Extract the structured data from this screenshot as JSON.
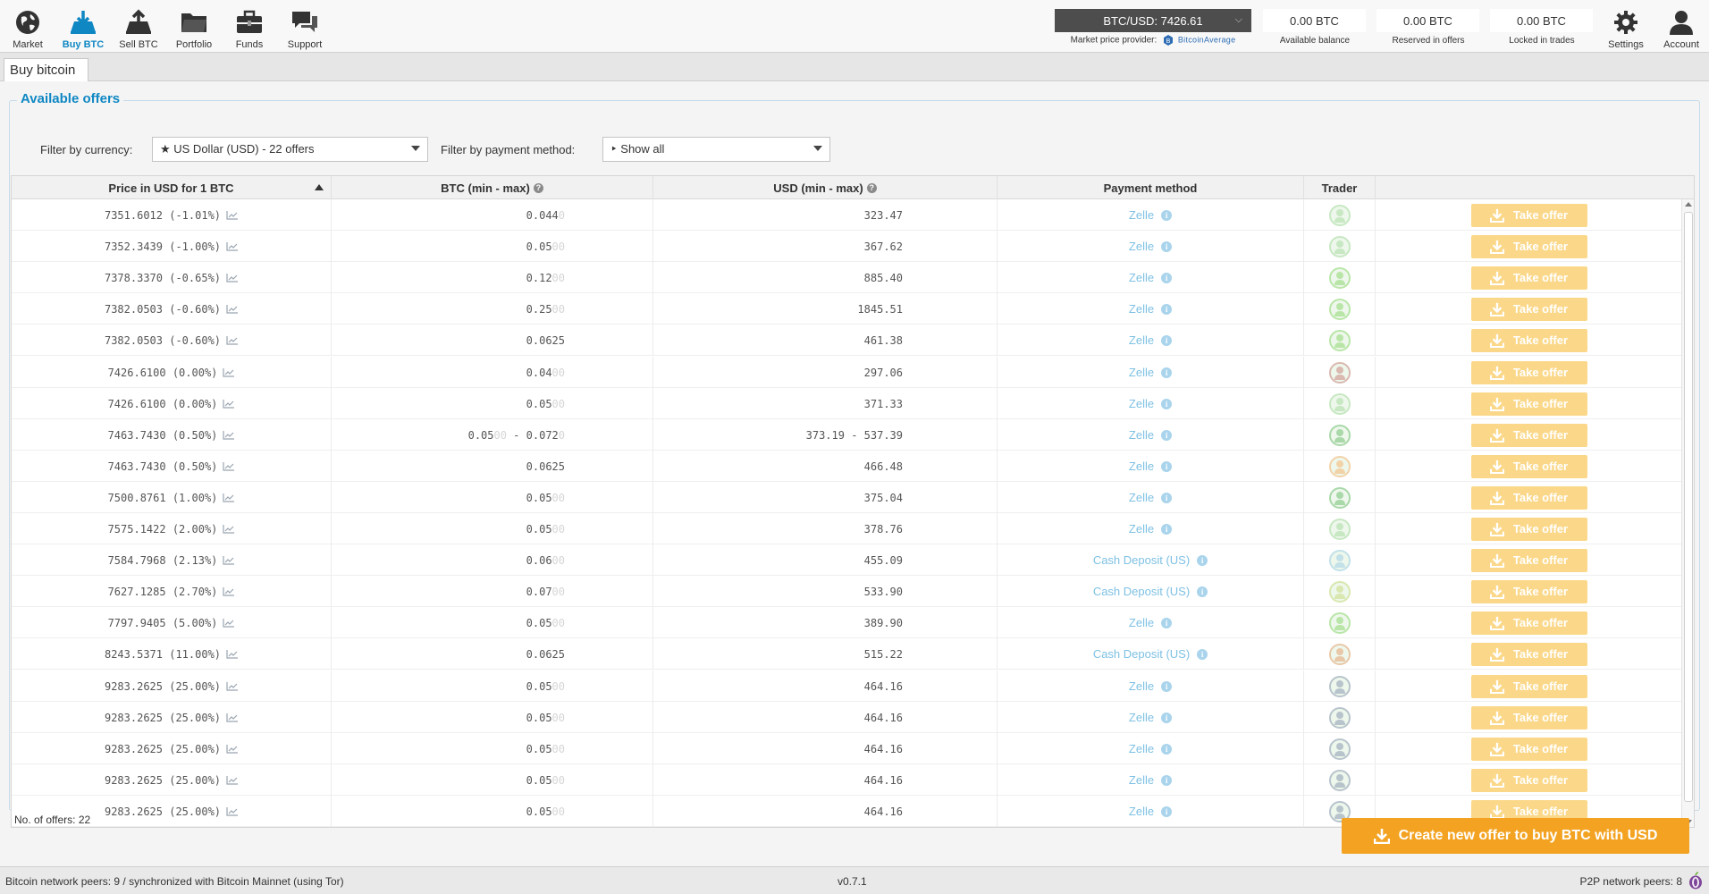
{
  "nav": {
    "items": [
      {
        "label": "Market",
        "icon": "globe-icon"
      },
      {
        "label": "Buy BTC",
        "icon": "buy-btc-icon",
        "active": true
      },
      {
        "label": "Sell BTC",
        "icon": "sell-btc-icon"
      },
      {
        "label": "Portfolio",
        "icon": "folder-icon"
      },
      {
        "label": "Funds",
        "icon": "briefcase-icon"
      },
      {
        "label": "Support",
        "icon": "chat-icon"
      }
    ],
    "settings_label": "Settings",
    "account_label": "Account"
  },
  "market_price": {
    "value": "BTC/USD: 7426.61",
    "provider_label": "Market price provider:",
    "provider_name": "BitcoinAverage"
  },
  "balances": {
    "available": {
      "value": "0.00 BTC",
      "label": "Available balance"
    },
    "reserved": {
      "value": "0.00 BTC",
      "label": "Reserved in offers"
    },
    "locked": {
      "value": "0.00 BTC",
      "label": "Locked in trades"
    }
  },
  "tab": {
    "label": "Buy bitcoin"
  },
  "offers": {
    "title": "Available offers",
    "filter_currency_label": "Filter by currency:",
    "filter_currency_value": "★ US Dollar (USD) - 22 offers",
    "filter_payment_label": "Filter by payment method:",
    "filter_payment_value": "‣ Show all",
    "columns": {
      "price": "Price in USD for 1 BTC",
      "btc": "BTC (min - max)",
      "usd": "USD (min - max)",
      "payment": "Payment method",
      "trader": "Trader"
    },
    "take_label": "Take offer",
    "rows": [
      {
        "price": "7351.6012 (-1.01%)",
        "btc": "0.044",
        "btc_pad": "0",
        "usd": "323.47",
        "payment": "Zelle",
        "avatar_color": "#c7e8c2"
      },
      {
        "price": "7352.3439 (-1.00%)",
        "btc": "0.05",
        "btc_pad": "00",
        "usd": "367.62",
        "payment": "Zelle",
        "avatar_color": "#c7e8c2"
      },
      {
        "price": "7378.3370 (-0.65%)",
        "btc": "0.12",
        "btc_pad": "00",
        "usd": "885.40",
        "payment": "Zelle",
        "avatar_color": "#b9e6a8"
      },
      {
        "price": "7382.0503 (-0.60%)",
        "btc": "0.25",
        "btc_pad": "00",
        "usd": "1845.51",
        "payment": "Zelle",
        "avatar_color": "#b9e6a8"
      },
      {
        "price": "7382.0503 (-0.60%)",
        "btc": "0.0625",
        "btc_pad": "",
        "usd": "461.38",
        "payment": "Zelle",
        "avatar_color": "#b9e6a8"
      },
      {
        "price": "7426.6100 (0.00%)",
        "btc": "0.04",
        "btc_pad": "00",
        "usd": "297.06",
        "payment": "Zelle",
        "avatar_color": "#d9b9b0"
      },
      {
        "price": "7426.6100 (0.00%)",
        "btc": "0.05",
        "btc_pad": "00",
        "usd": "371.33",
        "payment": "Zelle",
        "avatar_color": "#c7e8c2"
      },
      {
        "price": "7463.7430 (0.50%)",
        "btc": "0.05",
        "btc_pad": "00",
        "btc_max": "0.072",
        "btc_max_pad": "0",
        "usd": "373.19 - 537.39",
        "payment": "Zelle",
        "avatar_color": "#a9d8a9"
      },
      {
        "price": "7463.7430 (0.50%)",
        "btc": "0.0625",
        "btc_pad": "",
        "usd": "466.48",
        "payment": "Zelle",
        "avatar_color": "#f2d3a8"
      },
      {
        "price": "7500.8761 (1.00%)",
        "btc": "0.05",
        "btc_pad": "00",
        "usd": "375.04",
        "payment": "Zelle",
        "avatar_color": "#a9d8a9"
      },
      {
        "price": "7575.1422 (2.00%)",
        "btc": "0.05",
        "btc_pad": "00",
        "usd": "378.76",
        "payment": "Zelle",
        "avatar_color": "#c7e8c2"
      },
      {
        "price": "7584.7968 (2.13%)",
        "btc": "0.06",
        "btc_pad": "00",
        "usd": "455.09",
        "payment": "Cash Deposit (US)",
        "avatar_color": "#c2e1e8"
      },
      {
        "price": "7627.1285 (2.70%)",
        "btc": "0.07",
        "btc_pad": "00",
        "usd": "533.90",
        "payment": "Cash Deposit (US)",
        "avatar_color": "#d8e8b0"
      },
      {
        "price": "7797.9405 (5.00%)",
        "btc": "0.05",
        "btc_pad": "00",
        "usd": "389.90",
        "payment": "Zelle",
        "avatar_color": "#b9e6a8"
      },
      {
        "price": "8243.5371 (11.00%)",
        "btc": "0.0625",
        "btc_pad": "",
        "usd": "515.22",
        "payment": "Cash Deposit (US)",
        "avatar_color": "#e8c8a8"
      },
      {
        "price": "9283.2625 (25.00%)",
        "btc": "0.05",
        "btc_pad": "00",
        "usd": "464.16",
        "payment": "Zelle",
        "avatar_color": "#b8c4cc"
      },
      {
        "price": "9283.2625 (25.00%)",
        "btc": "0.05",
        "btc_pad": "00",
        "usd": "464.16",
        "payment": "Zelle",
        "avatar_color": "#b8c4cc"
      },
      {
        "price": "9283.2625 (25.00%)",
        "btc": "0.05",
        "btc_pad": "00",
        "usd": "464.16",
        "payment": "Zelle",
        "avatar_color": "#b8c4cc"
      },
      {
        "price": "9283.2625 (25.00%)",
        "btc": "0.05",
        "btc_pad": "00",
        "usd": "464.16",
        "payment": "Zelle",
        "avatar_color": "#b8c4cc"
      },
      {
        "price": "9283.2625 (25.00%)",
        "btc": "0.05",
        "btc_pad": "00",
        "usd": "464.16",
        "payment": "Zelle",
        "avatar_color": "#b8c4cc"
      }
    ],
    "count_label": "No. of offers: 22",
    "create_label": "Create new offer to buy BTC with USD"
  },
  "status": {
    "left": "Bitcoin network peers: 9 / synchronized with Bitcoin Mainnet (using Tor)",
    "version": "v0.7.1",
    "right": "P2P network peers: 8"
  },
  "colors": {
    "accent": "#0f87c3",
    "take_button": "#fbd889",
    "create_button": "#f3a321"
  }
}
